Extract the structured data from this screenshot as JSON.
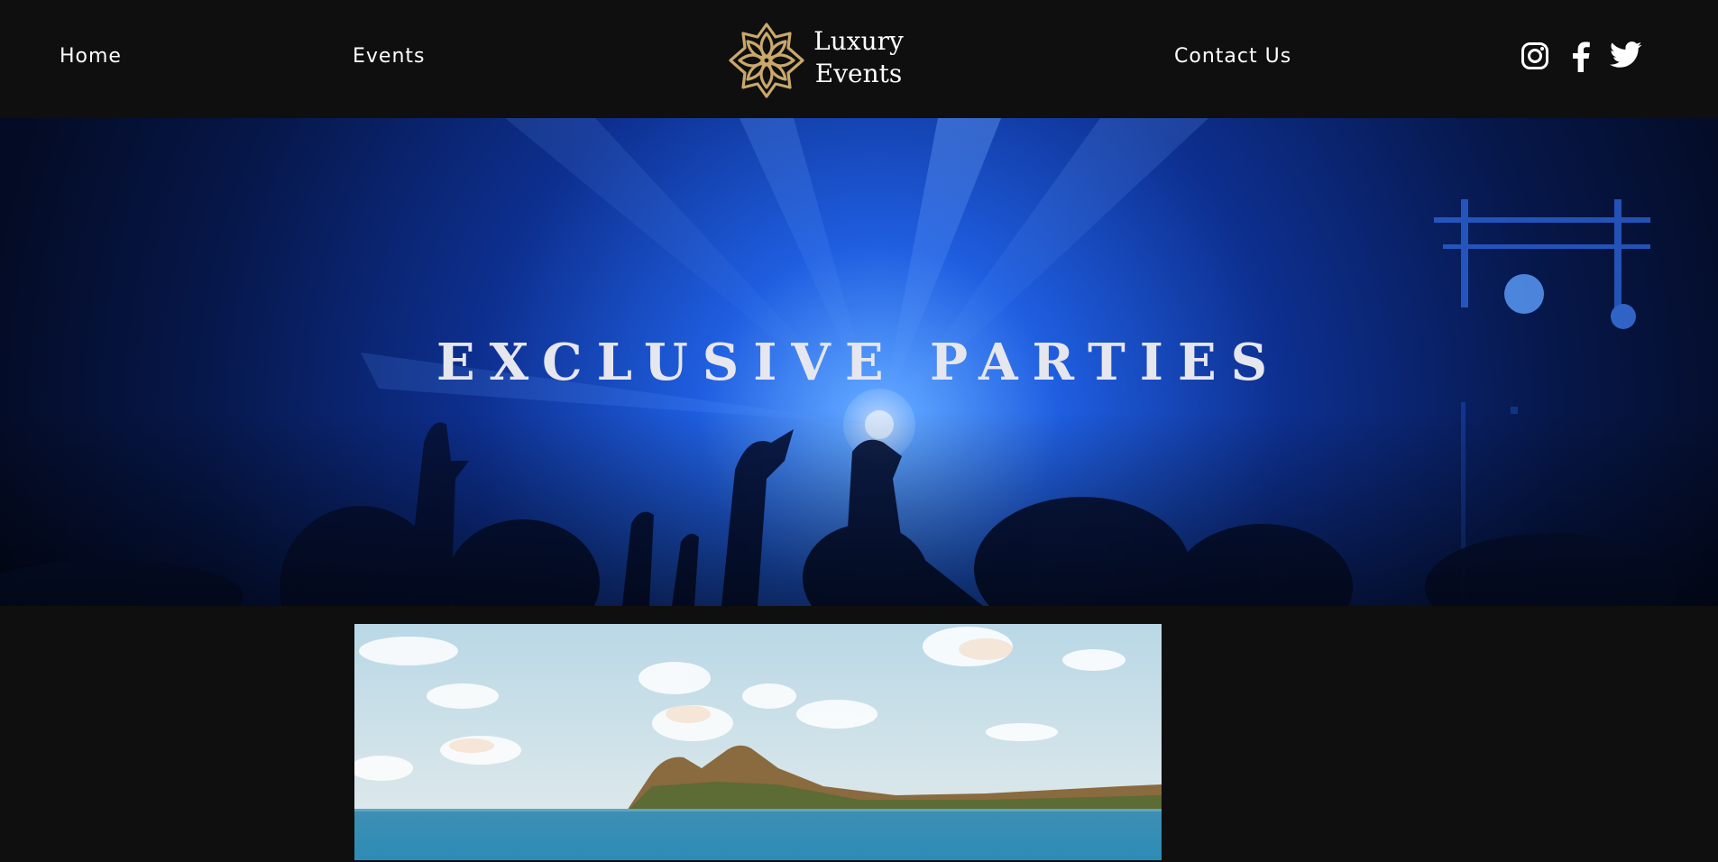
{
  "nav": {
    "home": "Home",
    "events": "Events",
    "contact": "Contact Us"
  },
  "logo": {
    "line1": "Luxury",
    "line2": "Events",
    "icon": "lotus-mandala-icon",
    "color": "#c9a86a"
  },
  "social": [
    {
      "icon": "instagram-icon"
    },
    {
      "icon": "facebook-icon"
    },
    {
      "icon": "twitter-icon"
    }
  ],
  "hero": {
    "title": "EXCLUSIVE PARTIES"
  },
  "colors": {
    "background": "#0f0f0f",
    "hero_blue": "#1e4fd8",
    "text": "#ffffff"
  }
}
